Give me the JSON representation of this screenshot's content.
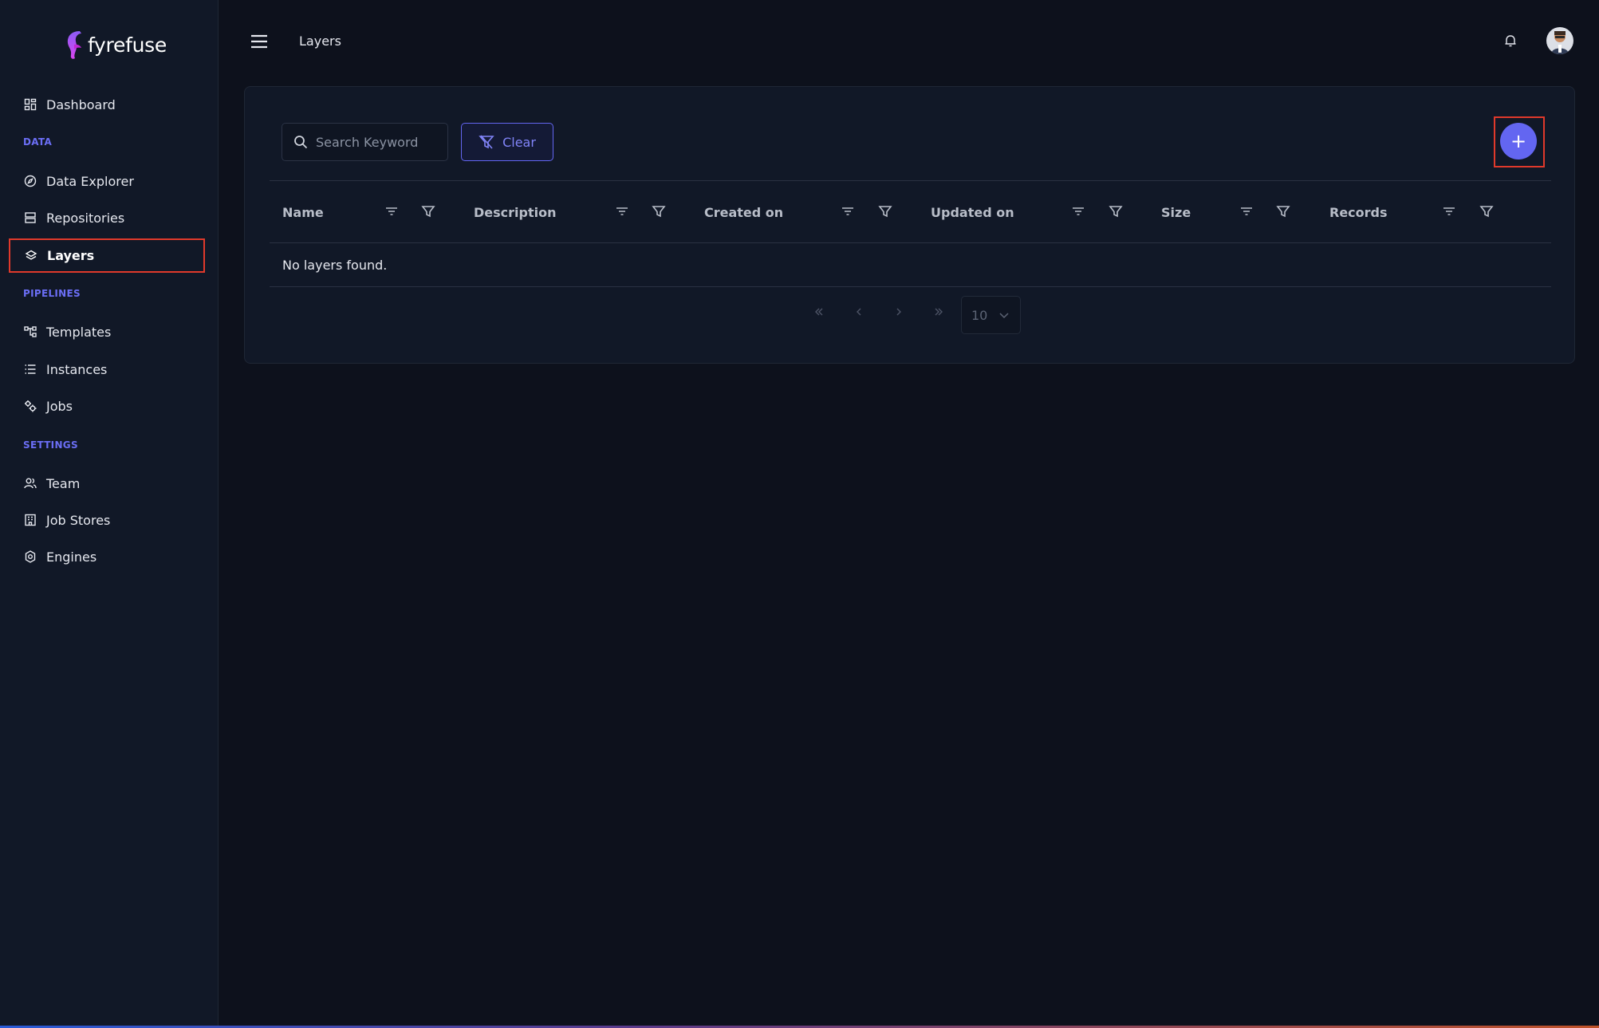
{
  "brand": {
    "name": "fyrefuse",
    "accent": "#6366f1",
    "highlight": "#e0392b"
  },
  "sidebar": {
    "dashboard": {
      "label": "Dashboard",
      "icon": "dashboard-icon"
    },
    "sections": {
      "data": "DATA",
      "pipelines": "PIPELINES",
      "settings": "SETTINGS"
    },
    "items": {
      "data_explorer": {
        "label": "Data Explorer",
        "icon": "compass-icon"
      },
      "repositories": {
        "label": "Repositories",
        "icon": "database-icon"
      },
      "layers": {
        "label": "Layers",
        "icon": "layers-icon",
        "active": true
      },
      "templates": {
        "label": "Templates",
        "icon": "flow-icon"
      },
      "instances": {
        "label": "Instances",
        "icon": "list-icon"
      },
      "jobs": {
        "label": "Jobs",
        "icon": "gears-icon"
      },
      "team": {
        "label": "Team",
        "icon": "users-icon"
      },
      "job_stores": {
        "label": "Job Stores",
        "icon": "building-icon"
      },
      "engines": {
        "label": "Engines",
        "icon": "engine-icon"
      }
    }
  },
  "header": {
    "title": "Layers"
  },
  "toolbar": {
    "search_placeholder": "Search Keyword",
    "clear_label": "Clear",
    "add_label": "+"
  },
  "table": {
    "columns": [
      "Name",
      "Description",
      "Created on",
      "Updated on",
      "Size",
      "Records"
    ],
    "empty_message": "No layers found."
  },
  "pagination": {
    "page_size": "10"
  }
}
